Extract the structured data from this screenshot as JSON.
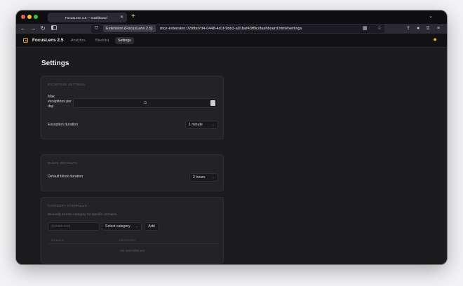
{
  "browser": {
    "tab_title": "FocusLens 2.5 — Dashboard",
    "url_chip": "Extension (FocusLens 2.5)",
    "url": "moz-extension://2bfbd7d4-0448-4d1f-9bb3-a91baf43ff9c/dashboard.html#settings"
  },
  "app": {
    "brand": "FocusLens 2.5",
    "nav": [
      {
        "label": "Analytics",
        "active": false
      },
      {
        "label": "Blacklist",
        "active": false
      },
      {
        "label": "Settings",
        "active": true
      }
    ]
  },
  "page": {
    "title": "Settings",
    "exception_settings": {
      "title": "EXCEPTION SETTINGS",
      "max_label": "Max exceptions per day",
      "max_value": "5",
      "duration_label": "Exception duration",
      "duration_value": "1 minute"
    },
    "block_defaults": {
      "title": "BLOCK DEFAULTS",
      "duration_label": "Default block duration",
      "duration_value": "2 hours"
    },
    "category_overrides": {
      "title": "CATEGORY OVERRIDES",
      "description": "Manually set the category for specific domains.",
      "domain_placeholder": "domain.com",
      "category_select": "Select category",
      "add_label": "Add",
      "col_domain": "DOMAIN",
      "col_category": "CATEGORY",
      "empty_text": "No overrides set."
    }
  },
  "colors": {
    "accent": "#f59e0b",
    "background": "#1c1b1d",
    "card": "#232225"
  },
  "icons": [
    "close-icon",
    "plus-icon",
    "back-icon",
    "forward-icon",
    "reload-icon",
    "sidebar-icon",
    "shield-icon",
    "extension-icon",
    "bookmark-star-icon",
    "qr-icon",
    "extensions-icon",
    "profile-icon",
    "save-icon",
    "menu-icon",
    "sun-icon",
    "chevron-down-icon"
  ]
}
